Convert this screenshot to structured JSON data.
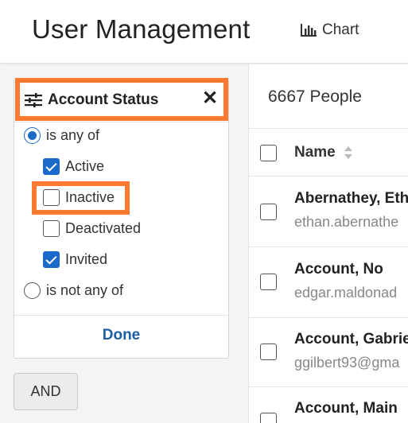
{
  "header": {
    "title": "User Management",
    "chart_label": "Chart"
  },
  "filter": {
    "title": "Account Status",
    "match_any_label": "is any of",
    "match_none_label": "is not any of",
    "selected_mode": "is any of",
    "options": [
      {
        "label": "Active",
        "checked": true
      },
      {
        "label": "Inactive",
        "checked": false
      },
      {
        "label": "Deactivated",
        "checked": false
      },
      {
        "label": "Invited",
        "checked": true
      }
    ],
    "done_label": "Done"
  },
  "logic_button": "AND",
  "table": {
    "count_label": "6667 People",
    "column_name": "Name",
    "rows": [
      {
        "name": "Abernathey, Eth",
        "email": "ethan.abernathe"
      },
      {
        "name": "Account, No",
        "email": "edgar.maldonad"
      },
      {
        "name": "Account, Gabrie",
        "email": "ggilbert93@gma"
      },
      {
        "name": "Account, Main",
        "email": ""
      }
    ]
  },
  "colors": {
    "accent": "#1a6ac9",
    "highlight": "#ff7a30",
    "link": "#1a5fa8"
  },
  "icons": [
    "chart-icon",
    "filter-sliders-icon",
    "close-icon",
    "sort-icon"
  ]
}
